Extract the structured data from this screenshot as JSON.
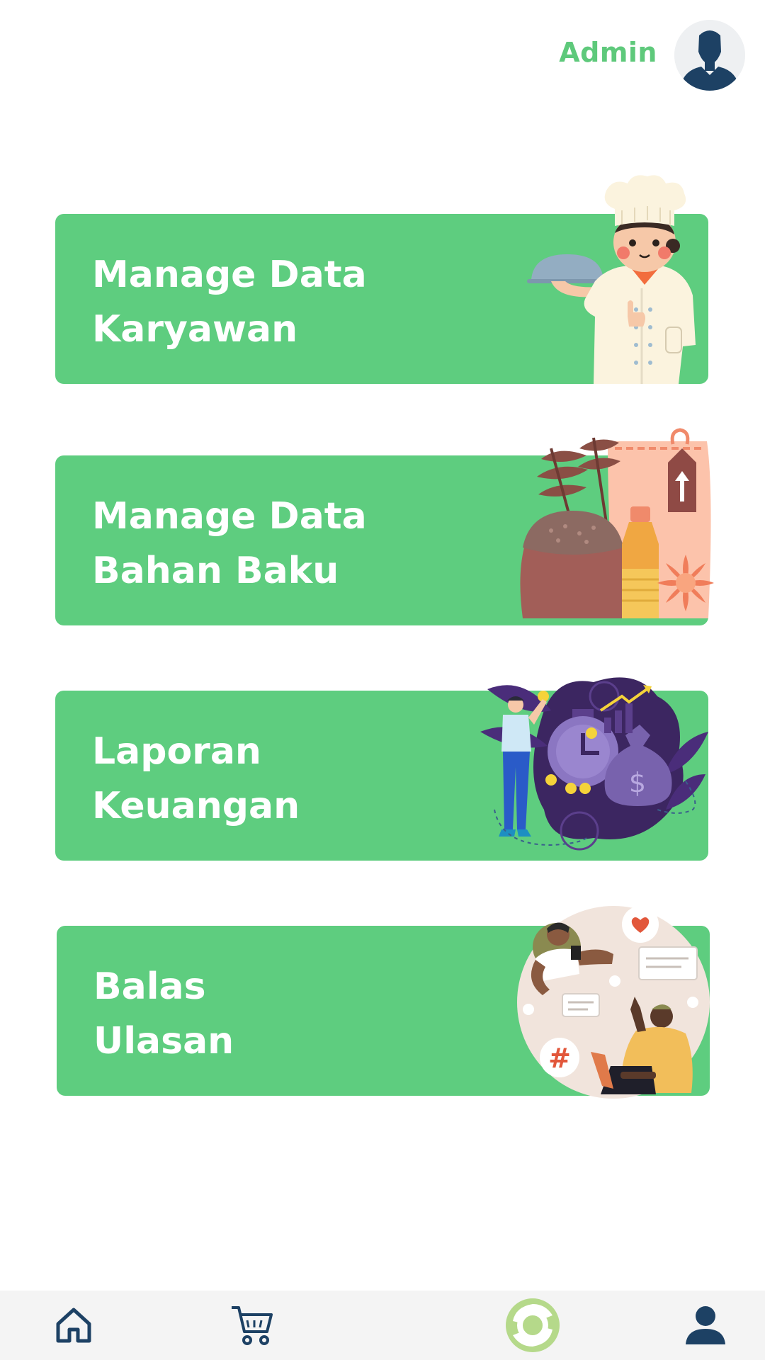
{
  "header": {
    "user_name": "Admin"
  },
  "menu": [
    {
      "line1": "Manage Data",
      "line2": "Karyawan",
      "illustration": "chef-illustration"
    },
    {
      "line1": "Manage Data",
      "line2": "Bahan Baku",
      "illustration": "ingredients-illustration"
    },
    {
      "line1": "Laporan",
      "line2": "Keuangan",
      "illustration": "finance-illustration"
    },
    {
      "line1": "Balas",
      "line2": "Ulasan",
      "illustration": "reviews-illustration"
    }
  ],
  "bottom_nav": [
    {
      "icon": "home-icon"
    },
    {
      "icon": "cart-icon"
    },
    {
      "icon": "sync-icon"
    },
    {
      "icon": "profile-icon"
    }
  ],
  "colors": {
    "accent": "#5ecd7f",
    "navy": "#1d4164",
    "nav_background": "#f4f4f4",
    "sync_icon": "#b5d98a"
  }
}
